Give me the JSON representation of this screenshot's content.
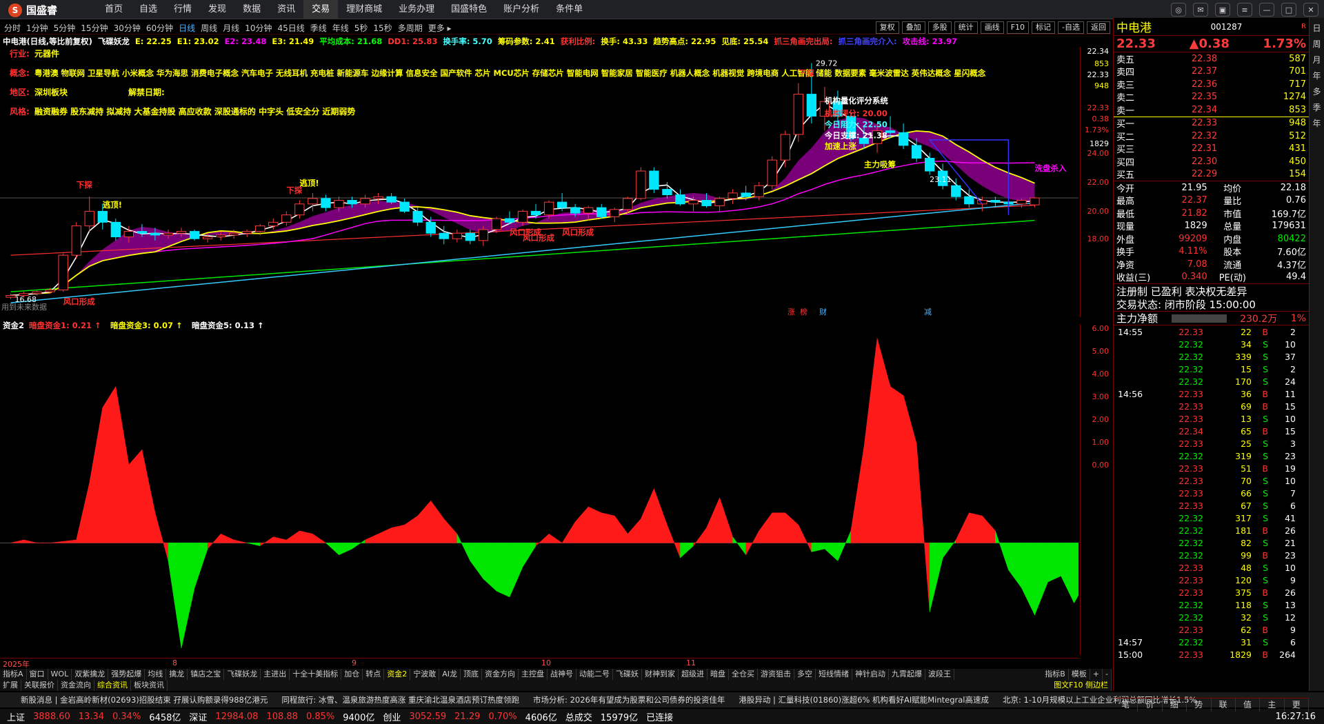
{
  "top": {
    "logo": "国盛睿",
    "nav": [
      "首页",
      "自选",
      "行情",
      "发现",
      "数据",
      "资讯",
      "交易",
      "理财商城",
      "业务办理",
      "国盛特色",
      "账户分析",
      "条件单"
    ],
    "active_nav": 6
  },
  "periods": [
    "分时",
    "1分钟",
    "5分钟",
    "15分钟",
    "30分钟",
    "60分钟",
    "日线",
    "周线",
    "月线",
    "10分钟",
    "45日线",
    "季线",
    "年线",
    "5秒",
    "15秒",
    "多周期",
    "更多 ▸"
  ],
  "active_period": 6,
  "chart_tools": [
    "复权",
    "叠加",
    "多股",
    "统计",
    "画线",
    "F10",
    "标记",
    "-自选",
    "返回"
  ],
  "info": [
    {
      "t": "中电港(日线,等比前复权)",
      "c": "#fff"
    },
    {
      "t": "飞碟妖龙",
      "c": "#fff"
    },
    {
      "t": "E: 22.25",
      "c": "#ff0"
    },
    {
      "t": "E1: 23.02",
      "c": "#ff0"
    },
    {
      "t": "E2: 23.48",
      "c": "#f0f"
    },
    {
      "t": "E3: 21.49",
      "c": "#ff0"
    },
    {
      "t": "平均成本: 21.68",
      "c": "#0f0"
    },
    {
      "t": "DD1: 25.83",
      "c": "#f33"
    },
    {
      "t": "换手率: 5.70",
      "c": "#4ff"
    },
    {
      "t": "筹码参数: 2.41",
      "c": "#ff0"
    },
    {
      "t": "获利比例:",
      "c": "#f33"
    },
    {
      "t": "换手: 43.33",
      "c": "#ff0"
    },
    {
      "t": "趋势高点: 22.95",
      "c": "#ff0"
    },
    {
      "t": "见底: 25.54",
      "c": "#ff0"
    },
    {
      "t": "抓三角画完出局:",
      "c": "#f33"
    },
    {
      "t": "抓三角画完介入:",
      "c": "#44f"
    },
    {
      "t": "攻击线: 23.97",
      "c": "#f0f"
    }
  ],
  "labels": {
    "industry_k": "行业:",
    "industry_v": "元器件",
    "concept_k": "概念:",
    "concept_v": "粤港澳 物联网 卫星导航 小米概念 华为海思 消费电子概念 汽车电子 无线耳机 充电桩 新能源车 边缘计算 信息安全 国产软件 芯片 MCU芯片 存储芯片 智能电网 智能家居 智能医疗 机器人概念 机器视觉 跨境电商 人工智能 储能 数据要素 毫米波雷达 英伟达概念 星闪概念",
    "region_k": "地区:",
    "region_v": "深圳板块",
    "unlock_k": "解禁日期:",
    "style_k": "风格:",
    "style_v": "融资融券 股东减持 拟减持 大基金持股 高应收款 深股通标的 中字头 低安全分 近期弱势",
    "future_data": "用到未来数据",
    "signals": [
      "下探",
      "逃顶!",
      "下探",
      "逃顶!",
      "下探",
      "风口形成",
      "风口形成",
      "风口形成",
      "风口形成",
      "洗盘杀入",
      "主力吸筹",
      "加速上涨",
      "机构量化评分系统",
      "机构评分: 20.00",
      "今日阻力: 22.50",
      "今日支撑: 21.38"
    ],
    "price_label_high": "29.72",
    "price_label_low": "16.68",
    "price_label_mid": "23.11",
    "event_labels": [
      "涨",
      "榜",
      "财",
      "减"
    ]
  },
  "main_axis": [
    "22.34",
    "853",
    "22.33",
    "948",
    "22.33",
    "0.38",
    "1.73%",
    "1829",
    "24.00",
    "22.00",
    "20.00",
    "18.00"
  ],
  "sub_info": [
    {
      "t": "资金2",
      "c": "#fff"
    },
    {
      "t": "暗盘资金1: 0.21 ↑",
      "c": "#f33"
    },
    {
      "t": "暗盘资金3: 0.07 ↑",
      "c": "#ff0"
    },
    {
      "t": "暗盘资金5: 0.13 ↑",
      "c": "#fff"
    }
  ],
  "sub_axis": [
    "6.00",
    "5.00",
    "4.00",
    "3.00",
    "2.00",
    "1.00",
    "0.00"
  ],
  "date_axis": [
    "2025年",
    "8",
    "9",
    "10",
    "11"
  ],
  "tabs1": [
    "指标A",
    "窗口",
    "WOL",
    "双紫擒龙",
    "强势起爆",
    "均线",
    "擒龙",
    "镇店之宝",
    "飞碟妖龙",
    "主进出",
    "十全十美指标",
    "加仓",
    "转点",
    "资金2",
    "宁波敢",
    "AI龙",
    "顶底",
    "资金方向",
    "主控盘",
    "战神号",
    "动能二号",
    "飞碟妖",
    "财神到家",
    "超级进",
    "暗盘",
    "全仓买",
    "游资狙击",
    "多空",
    "短线情绪",
    "神针启动",
    "九霄起爆",
    "波段王"
  ],
  "tabs1_right": [
    "指标B",
    "模板",
    "+",
    "-"
  ],
  "tabs2": [
    "扩展",
    "关联报价",
    "资金流向",
    "综合资讯",
    "板块资讯"
  ],
  "tabs2_right": "图文F10 侧边栏",
  "news": [
    "新股消息 | 金岩高岭新材(02693)招股结束 孖展认购额录得988亿港元",
    "同程旅行: 冰雪、温泉旅游热度高涨 重庆渝北温泉酒店预订热度领跑",
    "市场分析: 2026年有望成为股票和公司债券的投资佳年",
    "港股异动 | 汇量科技(01860)涨超6% 机构看好AI赋能Mintegral高速成",
    "北京: 1-10月规模以上工业企业利润总额同比增长1.5%"
  ],
  "status": [
    {
      "t": "上证",
      "c": "#fff"
    },
    {
      "t": "3888.60",
      "c": "#f33"
    },
    {
      "t": "13.34",
      "c": "#f33"
    },
    {
      "t": "0.34%",
      "c": "#f33"
    },
    {
      "t": "6458亿",
      "c": "#fff"
    },
    {
      "t": "深证",
      "c": "#fff"
    },
    {
      "t": "12984.08",
      "c": "#f33"
    },
    {
      "t": "108.88",
      "c": "#f33"
    },
    {
      "t": "0.85%",
      "c": "#f33"
    },
    {
      "t": "9400亿",
      "c": "#fff"
    },
    {
      "t": "创业",
      "c": "#fff"
    },
    {
      "t": "3052.59",
      "c": "#f33"
    },
    {
      "t": "21.29",
      "c": "#f33"
    },
    {
      "t": "0.70%",
      "c": "#f33"
    },
    {
      "t": "4606亿",
      "c": "#fff"
    },
    {
      "t": "总成交",
      "c": "#fff"
    },
    {
      "t": "15979亿",
      "c": "#fff"
    },
    {
      "t": "已连接",
      "c": "#fff"
    }
  ],
  "clock": "16:27:16",
  "quote": {
    "name": "中电港",
    "code": "001287",
    "price": "22.33",
    "change": "▲0.38",
    "pct": "1.73%",
    "asks": [
      [
        "卖五",
        "22.38",
        "587"
      ],
      [
        "卖四",
        "22.37",
        "701"
      ],
      [
        "卖三",
        "22.36",
        "717"
      ],
      [
        "卖二",
        "22.35",
        "1274"
      ],
      [
        "卖一",
        "22.34",
        "853"
      ]
    ],
    "bids": [
      [
        "买一",
        "22.33",
        "948"
      ],
      [
        "买二",
        "22.32",
        "512"
      ],
      [
        "买三",
        "22.31",
        "431"
      ],
      [
        "买四",
        "22.30",
        "450"
      ],
      [
        "买五",
        "22.29",
        "154"
      ]
    ],
    "stats": [
      [
        "今开",
        "21.95",
        "均价",
        "22.18"
      ],
      [
        "最高",
        "22.37",
        "量比",
        "0.76"
      ],
      [
        "最低",
        "21.82",
        "市值",
        "169.7亿"
      ],
      [
        "现量",
        "1829",
        "总量",
        "179631"
      ],
      [
        "外盘",
        "99209",
        "内盘",
        "80422"
      ],
      [
        "换手",
        "4.11%",
        "股本",
        "7.60亿"
      ],
      [
        "净资",
        "7.08",
        "流通",
        "4.37亿"
      ],
      [
        "收益(三)",
        "0.340",
        "PE(动)",
        "49.4"
      ]
    ],
    "reg": "注册制 已盈利 表决权无差异",
    "trade_state": "交易状态: 闭市阶段 15:00:00",
    "mainflow_label": "主力净额",
    "mainflow_val": "230.2万",
    "mainflow_pct": "1%"
  },
  "ticks": [
    [
      "14:55",
      "22.33",
      "22",
      "B",
      "2"
    ],
    [
      "",
      "22.32",
      "34",
      "S",
      "10"
    ],
    [
      "",
      "22.32",
      "339",
      "S",
      "37"
    ],
    [
      "",
      "22.32",
      "15",
      "S",
      "2"
    ],
    [
      "",
      "22.32",
      "170",
      "S",
      "24"
    ],
    [
      "14:56",
      "22.33",
      "36",
      "B",
      "11"
    ],
    [
      "",
      "22.33",
      "69",
      "B",
      "15"
    ],
    [
      "",
      "22.33",
      "13",
      "S",
      "10"
    ],
    [
      "",
      "22.34",
      "65",
      "B",
      "15"
    ],
    [
      "",
      "22.33",
      "25",
      "S",
      "3"
    ],
    [
      "",
      "22.32",
      "319",
      "S",
      "23"
    ],
    [
      "",
      "22.33",
      "51",
      "B",
      "19"
    ],
    [
      "",
      "22.33",
      "70",
      "S",
      "10"
    ],
    [
      "",
      "22.33",
      "66",
      "S",
      "7"
    ],
    [
      "",
      "22.33",
      "67",
      "S",
      "6"
    ],
    [
      "",
      "22.32",
      "317",
      "S",
      "41"
    ],
    [
      "",
      "22.32",
      "181",
      "B",
      "26"
    ],
    [
      "",
      "22.32",
      "82",
      "S",
      "21"
    ],
    [
      "",
      "22.32",
      "99",
      "B",
      "23"
    ],
    [
      "",
      "22.33",
      "48",
      "S",
      "10"
    ],
    [
      "",
      "22.33",
      "120",
      "S",
      "9"
    ],
    [
      "",
      "22.33",
      "375",
      "B",
      "26"
    ],
    [
      "",
      "22.32",
      "118",
      "S",
      "13"
    ],
    [
      "",
      "22.32",
      "32",
      "S",
      "12"
    ],
    [
      "",
      "22.33",
      "62",
      "B",
      "9"
    ],
    [
      "14:57",
      "22.32",
      "31",
      "S",
      "6"
    ],
    [
      "15:00",
      "22.33",
      "1829",
      "B",
      "264"
    ]
  ],
  "right_tabs": [
    "笔",
    "价",
    "细",
    "势",
    "联",
    "值",
    "主",
    "更"
  ],
  "side_strip": [
    "日",
    "周",
    "月",
    "年",
    "多",
    "季",
    "年"
  ],
  "colors": {
    "up": "#ff3c3c",
    "down": "#00e600",
    "accent": "#4ab4ff",
    "gold": "#ff0"
  },
  "chart_data": {
    "type": "candlestick",
    "main": {
      "ylim": [
        16,
        31
      ],
      "yticks": [
        "18.00",
        "20.00",
        "22.00",
        "24.00"
      ],
      "candles": [
        [
          16.9,
          17.1,
          16.8,
          17.0
        ],
        [
          17.0,
          17.2,
          16.9,
          17.1
        ],
        [
          17.1,
          17.3,
          17.0,
          17.2
        ],
        [
          17.2,
          17.4,
          17.1,
          17.3
        ],
        [
          17.3,
          19.3,
          17.2,
          19.2
        ],
        [
          19.2,
          21.0,
          19.0,
          20.8
        ],
        [
          20.8,
          22.4,
          20.5,
          21.6
        ],
        [
          21.6,
          22.0,
          20.6,
          21.0
        ],
        [
          21.0,
          21.2,
          20.0,
          20.2
        ],
        [
          20.2,
          20.8,
          19.9,
          20.5
        ],
        [
          20.5,
          20.9,
          20.2,
          20.4
        ],
        [
          20.4,
          20.7,
          20.0,
          20.3
        ],
        [
          20.3,
          20.6,
          20.1,
          20.4
        ],
        [
          20.4,
          20.7,
          20.2,
          20.5
        ],
        [
          20.5,
          20.6,
          20.0,
          20.1
        ],
        [
          20.1,
          20.4,
          19.9,
          20.2
        ],
        [
          20.2,
          20.5,
          20.0,
          20.3
        ],
        [
          20.3,
          20.6,
          20.1,
          20.4
        ],
        [
          20.4,
          20.6,
          20.2,
          20.5
        ],
        [
          20.5,
          20.9,
          20.3,
          20.8
        ],
        [
          20.8,
          21.2,
          20.6,
          21.0
        ],
        [
          21.0,
          21.6,
          20.8,
          21.4
        ],
        [
          21.4,
          22.2,
          21.2,
          22.0
        ],
        [
          22.0,
          22.6,
          21.6,
          22.3
        ],
        [
          22.3,
          22.5,
          21.6,
          21.8
        ],
        [
          21.8,
          22.4,
          21.6,
          22.2
        ],
        [
          22.2,
          22.4,
          21.8,
          22.0
        ],
        [
          22.0,
          22.5,
          21.8,
          22.3
        ],
        [
          22.3,
          22.6,
          22.0,
          22.4
        ],
        [
          22.4,
          22.6,
          22.0,
          22.1
        ],
        [
          22.1,
          22.3,
          21.5,
          21.6
        ],
        [
          21.6,
          21.8,
          20.8,
          21.0
        ],
        [
          21.0,
          21.3,
          20.2,
          20.4
        ],
        [
          20.4,
          20.8,
          19.8,
          20.1
        ],
        [
          20.1,
          20.6,
          19.9,
          20.4
        ],
        [
          20.4,
          20.6,
          19.8,
          20.0
        ],
        [
          20.0,
          20.8,
          19.7,
          20.6
        ],
        [
          20.6,
          21.3,
          20.4,
          21.2
        ],
        [
          21.2,
          21.6,
          20.9,
          21.0
        ],
        [
          21.0,
          21.7,
          20.8,
          21.6
        ],
        [
          21.6,
          22.0,
          21.2,
          21.4
        ],
        [
          21.4,
          22.2,
          21.2,
          22.1
        ],
        [
          22.1,
          22.6,
          21.6,
          21.8
        ],
        [
          21.8,
          22.0,
          21.3,
          21.5
        ],
        [
          21.5,
          21.9,
          21.1,
          21.8
        ],
        [
          21.8,
          22.0,
          21.2,
          21.3
        ],
        [
          21.3,
          21.8,
          21.0,
          21.7
        ],
        [
          21.7,
          22.4,
          21.5,
          22.3
        ],
        [
          22.3,
          24.0,
          22.2,
          23.8
        ],
        [
          23.8,
          24.0,
          22.6,
          22.8
        ],
        [
          22.8,
          23.2,
          22.3,
          22.5
        ],
        [
          22.5,
          22.8,
          21.9,
          22.0
        ],
        [
          22.0,
          22.4,
          21.6,
          22.2
        ],
        [
          22.2,
          22.6,
          21.8,
          21.9
        ],
        [
          21.9,
          22.4,
          21.6,
          22.3
        ],
        [
          22.3,
          22.8,
          22.0,
          22.6
        ],
        [
          22.6,
          23.0,
          22.2,
          22.4
        ],
        [
          22.4,
          23.2,
          22.2,
          23.0
        ],
        [
          23.0,
          24.6,
          22.8,
          24.4
        ],
        [
          24.4,
          26.0,
          24.0,
          25.8
        ],
        [
          25.8,
          28.6,
          25.4,
          28.0
        ],
        [
          28.0,
          29.7,
          26.4,
          26.8
        ],
        [
          26.8,
          28.4,
          26.0,
          27.6
        ],
        [
          27.6,
          28.2,
          26.4,
          26.8
        ],
        [
          26.8,
          27.0,
          25.4,
          25.6
        ],
        [
          25.6,
          26.2,
          25.0,
          25.3
        ],
        [
          25.3,
          26.4,
          24.8,
          26.0
        ],
        [
          26.0,
          26.8,
          25.6,
          25.9
        ],
        [
          25.9,
          26.4,
          25.0,
          25.2
        ],
        [
          25.2,
          25.6,
          24.3,
          24.5
        ],
        [
          24.5,
          24.8,
          23.6,
          23.8
        ],
        [
          23.8,
          24.2,
          22.8,
          23.0
        ],
        [
          23.0,
          23.4,
          22.2,
          22.4
        ],
        [
          22.4,
          22.8,
          21.8,
          22.0
        ],
        [
          22.0,
          22.4,
          21.6,
          22.2
        ],
        [
          22.2,
          22.4,
          21.8,
          22.1
        ],
        [
          22.1,
          22.4,
          21.9,
          22.0
        ],
        [
          22.0,
          22.3,
          21.8,
          22.2
        ],
        [
          21.95,
          22.37,
          21.82,
          22.33
        ]
      ],
      "series": [
        {
          "name": "E3",
          "color": "#ffffff"
        },
        {
          "name": "E1",
          "color": "#ffff00"
        },
        {
          "name": "E2",
          "color": "#ff00ff"
        },
        {
          "name": "DD1",
          "color": "#ff3030"
        },
        {
          "name": "平均成本",
          "color": "#00e600"
        },
        {
          "name": "换手率",
          "color": "#33ccff"
        }
      ]
    },
    "sub": {
      "type": "area",
      "ylim": [
        -3.5,
        7
      ],
      "yticks": [
        "0.00",
        "1.00",
        "2.00",
        "3.00",
        "4.00",
        "5.00",
        "6.00"
      ],
      "values": [
        0.0,
        0.1,
        0.0,
        0.0,
        0.05,
        0.1,
        2.0,
        4.5,
        5.2,
        2.6,
        3.1,
        1.0,
        -0.6,
        -3.5,
        -1.5,
        -0.2,
        0.3,
        0.1,
        0.0,
        -0.1,
        0.2,
        0.1,
        0.4,
        0.3,
        0.0,
        -0.4,
        -0.2,
        0.1,
        0.3,
        0.5,
        0.6,
        0.9,
        1.4,
        0.8,
        0.3,
        -0.6,
        -1.2,
        -1.6,
        -1.8,
        -0.8,
        -0.1,
        0.3,
        0.0,
        0.7,
        1.2,
        1.0,
        0.9,
        0.3,
        0.8,
        1.8,
        0.6,
        -0.5,
        -0.1,
        0.5,
        1.5,
        0.2,
        -0.4,
        0.4,
        1.0,
        1.0,
        0.6,
        -0.3,
        -0.2,
        -0.6,
        0.4,
        3.2,
        6.8,
        5.2,
        4.9,
        3.3,
        -2.3,
        -0.5,
        0.1,
        1.0,
        0.9,
        0.4,
        -0.9,
        -1.5,
        -2.4,
        -1.3,
        -1.1,
        -2.0,
        -1.2,
        -0.1,
        0.0
      ]
    }
  }
}
